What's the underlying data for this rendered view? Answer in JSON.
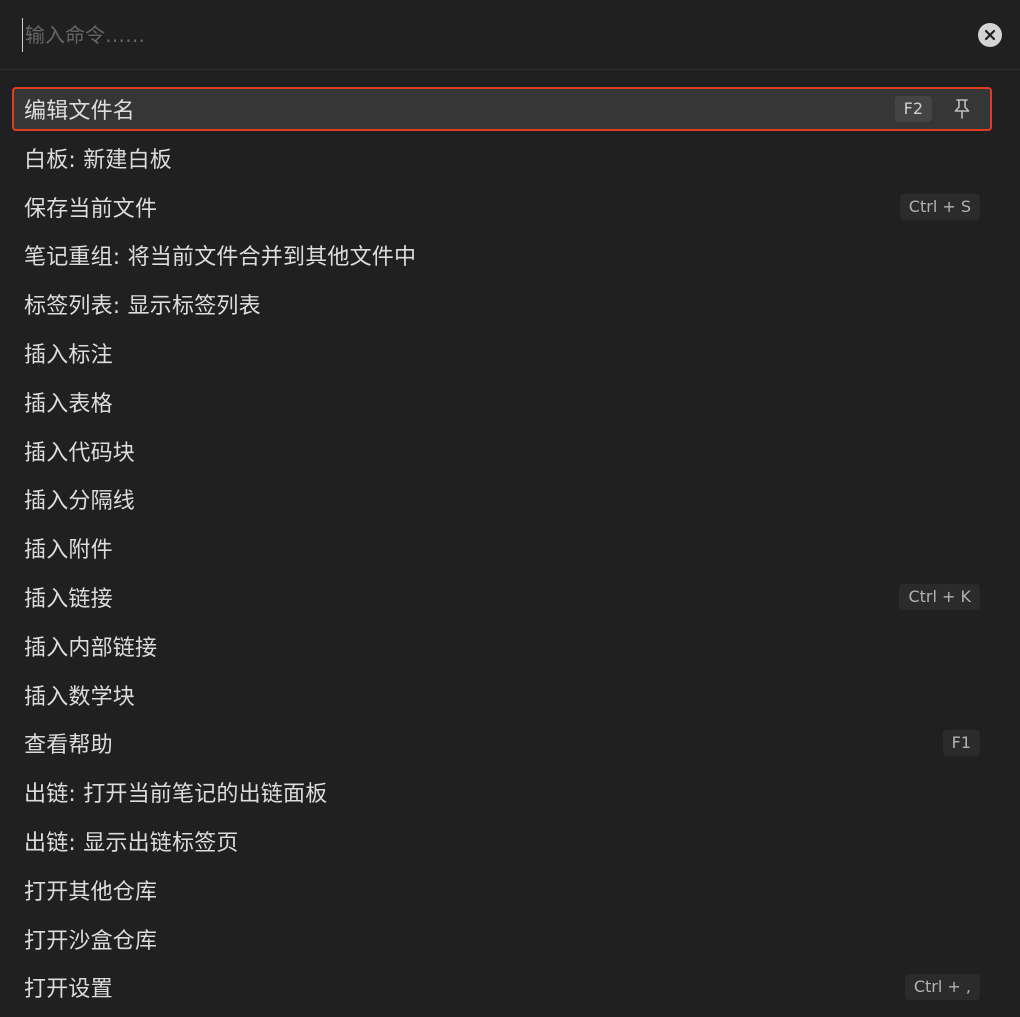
{
  "search": {
    "placeholder": "输入命令……",
    "value": "",
    "clear_icon": "close-circle-icon"
  },
  "commands": [
    {
      "label": "编辑文件名",
      "hotkey": "F2",
      "selected": true,
      "pin_icon": "pin-icon"
    },
    {
      "label": "白板: 新建白板",
      "hotkey": ""
    },
    {
      "label": "保存当前文件",
      "hotkey": "Ctrl + S"
    },
    {
      "label": "笔记重组: 将当前文件合并到其他文件中",
      "hotkey": ""
    },
    {
      "label": "标签列表: 显示标签列表",
      "hotkey": ""
    },
    {
      "label": "插入标注",
      "hotkey": ""
    },
    {
      "label": "插入表格",
      "hotkey": ""
    },
    {
      "label": "插入代码块",
      "hotkey": ""
    },
    {
      "label": "插入分隔线",
      "hotkey": ""
    },
    {
      "label": "插入附件",
      "hotkey": ""
    },
    {
      "label": "插入链接",
      "hotkey": "Ctrl + K"
    },
    {
      "label": "插入内部链接",
      "hotkey": ""
    },
    {
      "label": "插入数学块",
      "hotkey": ""
    },
    {
      "label": "查看帮助",
      "hotkey": "F1"
    },
    {
      "label": "出链: 打开当前笔记的出链面板",
      "hotkey": ""
    },
    {
      "label": "出链: 显示出链标签页",
      "hotkey": ""
    },
    {
      "label": "打开其他仓库",
      "hotkey": ""
    },
    {
      "label": "打开沙盒仓库",
      "hotkey": ""
    },
    {
      "label": "打开设置",
      "hotkey": "Ctrl + ,"
    }
  ],
  "colors": {
    "background": "#202020",
    "selected_bg": "#363636",
    "highlight_border": "#e03c21",
    "text": "#dcddde",
    "hotkey_bg": "#2b2b2b"
  }
}
